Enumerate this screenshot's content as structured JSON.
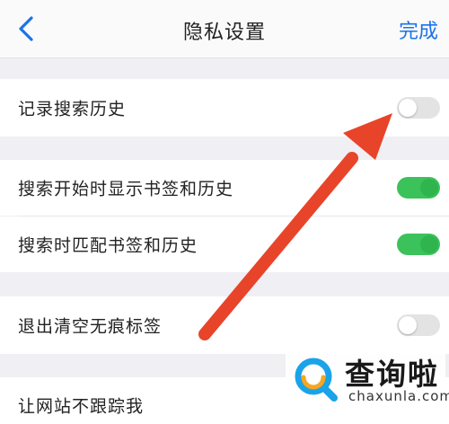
{
  "header": {
    "title": "隐私设置",
    "done_label": "完成",
    "back_icon": "chevron-left-icon",
    "accent_color": "#1a73e8"
  },
  "settings": [
    {
      "label": "记录搜索历史",
      "enabled": false
    },
    {
      "label": "搜索开始时显示书签和历史",
      "enabled": true
    },
    {
      "label": "搜索时匹配书签和历史",
      "enabled": true
    },
    {
      "label": "退出清空无痕标签",
      "enabled": false
    },
    {
      "label": "让网站不跟踪我",
      "enabled": false
    }
  ],
  "annotation": {
    "icon": "arrow-icon",
    "color": "#e8442a"
  },
  "watermark": {
    "text_cn": "查询啦",
    "text_en": "chaxunla.com"
  }
}
